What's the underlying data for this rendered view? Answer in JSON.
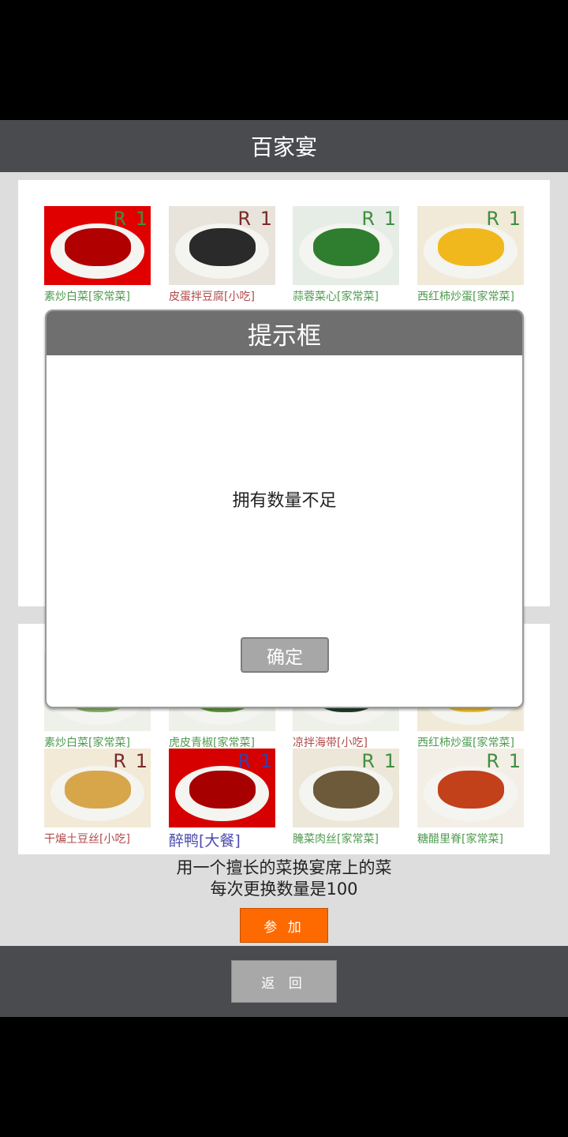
{
  "header": {
    "title": "百家宴"
  },
  "top_dishes": [
    {
      "name": "素炒白菜[家常菜]",
      "tag": "R 1",
      "name_color": "#4f9a4f",
      "tag_color": "#3f8f3f",
      "bg": "#e00000",
      "food": "#b00000"
    },
    {
      "name": "皮蛋拌豆腐[小吃]",
      "tag": "R 1",
      "name_color": "#b04a4a",
      "tag_color": "#7a2a2a",
      "bg": "#e8e4dc",
      "food": "#2a2a2a"
    },
    {
      "name": "蒜蓉菜心[家常菜]",
      "tag": "R 1",
      "name_color": "#4f9a4f",
      "tag_color": "#3f8f3f",
      "bg": "#e6ece6",
      "food": "#2f7d2f"
    },
    {
      "name": "西红柿炒蛋[家常菜]",
      "tag": "R 1",
      "name_color": "#4f9a4f",
      "tag_color": "#3f8f3f",
      "bg": "#f1ead8",
      "food": "#f1b81e"
    }
  ],
  "bottom_dishes": [
    {
      "name": "素炒白菜[家常菜]",
      "tag": "",
      "name_color": "#4f9a4f",
      "tag_color": "#3f8f3f",
      "bg": "#eef0ea",
      "food": "#8ab86a"
    },
    {
      "name": "虎皮青椒[家常菜]",
      "tag": "",
      "name_color": "#4f9a4f",
      "tag_color": "#3f8f3f",
      "bg": "#eef0ea",
      "food": "#5f9a3a"
    },
    {
      "name": "凉拌海带[小吃]",
      "tag": "",
      "name_color": "#b04a4a",
      "tag_color": "#7a2a2a",
      "bg": "#eef0ea",
      "food": "#1f3f2a"
    },
    {
      "name": "西红柿炒蛋[家常菜]",
      "tag": "",
      "name_color": "#4f9a4f",
      "tag_color": "#3f8f3f",
      "bg": "#f1ead8",
      "food": "#f3c02a"
    },
    {
      "name": "干煸土豆丝[小吃]",
      "tag": "R 1",
      "name_color": "#b04a4a",
      "tag_color": "#7a2a2a",
      "bg": "#f2ead6",
      "food": "#d7a64a"
    },
    {
      "name": "醉鸭[大餐]",
      "tag": "R 1",
      "name_color": "#4a4ab0",
      "tag_color": "#3f3f9f",
      "bg": "#d60000",
      "food": "#a60000"
    },
    {
      "name": "腌菜肉丝[家常菜]",
      "tag": "R 1",
      "name_color": "#4f9a4f",
      "tag_color": "#3f8f3f",
      "bg": "#ece7d8",
      "food": "#6d5a3a"
    },
    {
      "name": "糖醋里脊[家常菜]",
      "tag": "R 1",
      "name_color": "#4f9a4f",
      "tag_color": "#3f8f3f",
      "bg": "#f4efe6",
      "food": "#c2401a"
    }
  ],
  "info": {
    "line1": "用一个擅长的菜换宴席上的菜",
    "line2": "每次更换数量是100"
  },
  "join_button": {
    "label": "参 加"
  },
  "back_button": {
    "label": "返 回"
  },
  "dialog": {
    "title": "提示框",
    "message": "拥有数量不足",
    "ok_label": "确定"
  }
}
